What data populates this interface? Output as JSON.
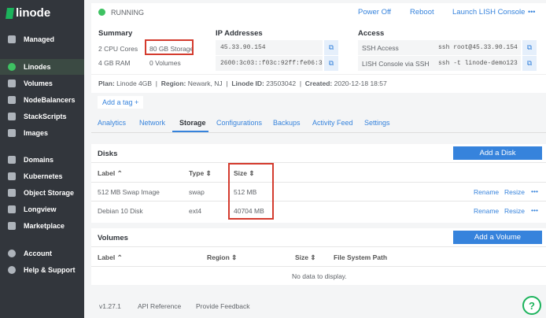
{
  "sidebar": {
    "logo": "linode",
    "items": [
      {
        "label": "Managed",
        "icon": "managed-icon"
      },
      {
        "label": "Linodes",
        "icon": "linode-hex-icon",
        "active": true
      },
      {
        "label": "Volumes",
        "icon": "volumes-icon"
      },
      {
        "label": "NodeBalancers",
        "icon": "nodebalancer-icon"
      },
      {
        "label": "StackScripts",
        "icon": "stackscript-icon"
      },
      {
        "label": "Images",
        "icon": "images-icon"
      },
      {
        "label": "Domains",
        "icon": "globe-icon"
      },
      {
        "label": "Kubernetes",
        "icon": "kubernetes-icon"
      },
      {
        "label": "Object Storage",
        "icon": "bucket-icon"
      },
      {
        "label": "Longview",
        "icon": "pulse-icon"
      },
      {
        "label": "Marketplace",
        "icon": "lock-icon"
      },
      {
        "label": "Account",
        "icon": "account-icon"
      },
      {
        "label": "Help & Support",
        "icon": "help-icon"
      }
    ]
  },
  "header": {
    "status": "RUNNING",
    "status_color": "#3ec262",
    "power_off": "Power Off",
    "reboot": "Reboot",
    "lish": "Launch LISH Console",
    "more": "•••"
  },
  "summary": {
    "title": "Summary",
    "cpu": "2 CPU Cores",
    "storage": "80 GB Storage",
    "ram": "4 GB RAM",
    "volumes": "0 Volumes"
  },
  "ip": {
    "title": "IP Addresses",
    "ipv4": "45.33.90.154",
    "ipv6": "2600:3c03::f03c:92ff:fe06:3"
  },
  "access": {
    "title": "Access",
    "ssh_label": "SSH Access",
    "ssh_value": "ssh root@45.33.90.154",
    "lish_label": "LISH Console via SSH",
    "lish_value": "ssh -t linode-demo123"
  },
  "meta": {
    "plan_label": "Plan:",
    "plan": "Linode 4GB",
    "region_label": "Region:",
    "region": "Newark, NJ",
    "id_label": "Linode ID:",
    "id": "23503042",
    "created_label": "Created:",
    "created": "2020-12-18 18:57"
  },
  "add_tag": "Add a tag  +",
  "tabs": [
    "Analytics",
    "Network",
    "Storage",
    "Configurations",
    "Backups",
    "Activity Feed",
    "Settings"
  ],
  "active_tab": "Storage",
  "disks": {
    "title": "Disks",
    "add": "Add a Disk",
    "columns": [
      "Label",
      "Type",
      "Size"
    ],
    "rows": [
      {
        "label": "512 MB Swap Image",
        "type": "swap",
        "size": "512 MB"
      },
      {
        "label": "Debian 10 Disk",
        "type": "ext4",
        "size": "40704 MB"
      }
    ],
    "rename": "Rename",
    "resize": "Resize"
  },
  "volumes": {
    "title": "Volumes",
    "add": "Add a Volume",
    "columns": [
      "Label",
      "Region",
      "Size",
      "File System Path"
    ],
    "empty": "No data to display."
  },
  "footer": {
    "version": "v1.27.1",
    "api": "API Reference",
    "feedback": "Provide Feedback"
  },
  "help_fab": "?"
}
